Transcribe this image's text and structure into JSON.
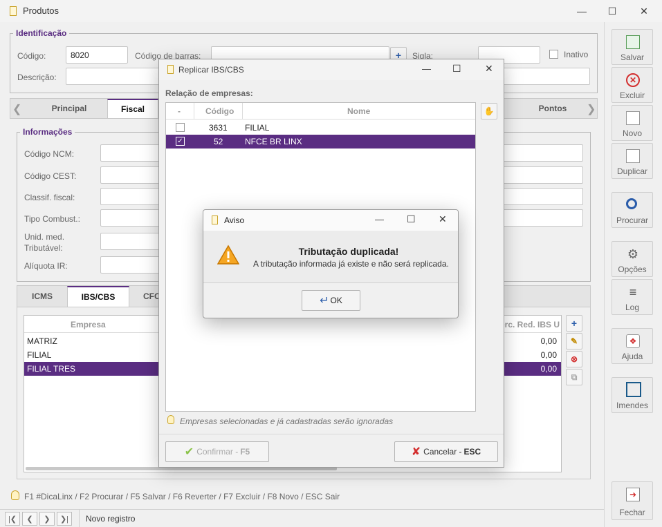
{
  "window": {
    "title": "Produtos"
  },
  "identificacao": {
    "legend": "Identificação",
    "codigo_label": "Código:",
    "codigo_value": "8020",
    "codigo_barras_label": "Código de barras:",
    "sigla_label": "Sigla:",
    "inativo_label": "Inativo",
    "descricao_label": "Descrição:"
  },
  "main_tabs": [
    "Principal",
    "Fiscal",
    "Pontos"
  ],
  "informacoes": {
    "legend": "Informações",
    "labels": [
      "Código NCM:",
      "Código CEST:",
      "Classif. fiscal:",
      "Tipo Combust.:",
      "Unid. med.",
      "Tributável:",
      "Alíquota IR:"
    ]
  },
  "sub_tabs": [
    "ICMS",
    "IBS/CBS",
    "CFO"
  ],
  "empresa_grid": {
    "col_empresa": "Empresa",
    "col_red": "erc. Red. IBS U",
    "rows": [
      {
        "empresa": "MATRIZ",
        "value": "0,00"
      },
      {
        "empresa": "FILIAL",
        "value": "0,00"
      },
      {
        "empresa": "FILIAL TRES",
        "value": "0,00"
      }
    ]
  },
  "hotkeys": "F1 #DicaLinx / F2 Procurar / F5 Salvar / F6 Reverter / F7 Excluir / F8 Novo / ESC Sair",
  "status": "Novo registro",
  "sidebar": {
    "salvar": "Salvar",
    "excluir": "Excluir",
    "novo": "Novo",
    "duplicar": "Duplicar",
    "procurar": "Procurar",
    "opcoes": "Opções",
    "log": "Log",
    "ajuda": "Ajuda",
    "imendes": "Imendes",
    "fechar": "Fechar"
  },
  "replicar": {
    "title": "Replicar IBS/CBS",
    "relacao_label": "Relação de empresas:",
    "col_check": "-",
    "col_codigo": "Código",
    "col_nome": "Nome",
    "rows": [
      {
        "codigo": "3631",
        "nome": "FILIAL",
        "checked": false
      },
      {
        "codigo": "52",
        "nome": "NFCE BR LINX",
        "checked": true
      }
    ],
    "hint": "Empresas selecionadas e já cadastradas serão ignoradas",
    "confirmar_label": "Confirmar - ",
    "confirmar_key": "F5",
    "cancelar_label": "Cancelar - ",
    "cancelar_key": "ESC"
  },
  "aviso": {
    "title": "Aviso",
    "heading": "Tributação duplicada!",
    "message": "A tributação informada já existe e não será replicada.",
    "ok_label": "OK"
  },
  "colors": {
    "accent": "#5a2d82",
    "warning": "#f5a623",
    "danger": "#d32f2f"
  }
}
